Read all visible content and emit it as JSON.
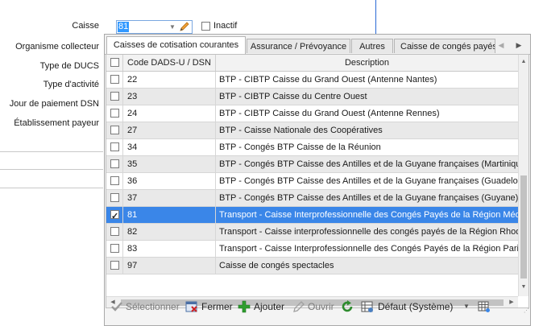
{
  "form": {
    "caisse_label": "Caisse",
    "caisse_value": "81",
    "inactif_label": "Inactif",
    "organisme_label": "Organisme collecteur",
    "type_ducs_label": "Type de DUCS",
    "type_activite_label": "Type d'activité",
    "jour_paiement_label": "Jour de paiement DSN",
    "etablissement_label": "Établissement payeur"
  },
  "tabs": [
    {
      "label": "Caisses de cotisation courantes",
      "active": true
    },
    {
      "label": "Assurance / Prévoyance",
      "active": false
    },
    {
      "label": "Autres",
      "active": false
    },
    {
      "label": "Caisse de congés payés",
      "active": false
    }
  ],
  "grid": {
    "col_code": "Code DADS-U / DSN",
    "col_desc": "Description",
    "rows": [
      {
        "code": "22",
        "desc": "BTP - CIBTP Caisse du Grand Ouest (Antenne Nantes)",
        "checked": false,
        "selected": false
      },
      {
        "code": "23",
        "desc": "BTP - CIBTP Caisse du Centre Ouest",
        "checked": false,
        "selected": false
      },
      {
        "code": "24",
        "desc": "BTP - CIBTP Caisse du Grand Ouest (Antenne Rennes)",
        "checked": false,
        "selected": false
      },
      {
        "code": "27",
        "desc": "BTP - Caisse Nationale des Coopératives",
        "checked": false,
        "selected": false
      },
      {
        "code": "34",
        "desc": "BTP - Congés BTP Caisse de la Réunion",
        "checked": false,
        "selected": false
      },
      {
        "code": "35",
        "desc": "BTP - Congés BTP Caisse des Antilles et de la Guyane françaises (Martinique)",
        "checked": false,
        "selected": false
      },
      {
        "code": "36",
        "desc": "BTP - Congés BTP Caisse des Antilles et de la Guyane françaises (Guadeloupe)",
        "checked": false,
        "selected": false
      },
      {
        "code": "37",
        "desc": "BTP - Congés BTP Caisse des Antilles et de la Guyane françaises (Guyane)",
        "checked": false,
        "selected": false
      },
      {
        "code": "81",
        "desc": "Transport - Caisse Interprofessionnelle des Congés Payés de la Région Méditerranée",
        "checked": true,
        "selected": true
      },
      {
        "code": "82",
        "desc": "Transport - Caisse interprofessionnelle des congés payés de la Région Rhodanienne",
        "checked": false,
        "selected": false
      },
      {
        "code": "83",
        "desc": "Transport - Caisse Interprofessionnelle des Congés Payés de la Région Parisienne",
        "checked": false,
        "selected": false
      },
      {
        "code": "97",
        "desc": "Caisse de congés spectacles",
        "checked": false,
        "selected": false
      }
    ]
  },
  "toolbar": {
    "select_label": "Sélectionner",
    "close_label": "Fermer",
    "add_label": "Ajouter",
    "open_label": "Ouvrir",
    "view_label": "Défaut (Système)"
  },
  "colors": {
    "accent": "#3a86e8",
    "selection_text": "#ffffff",
    "add_icon": "#2e9e2e",
    "refresh_icon": "#2e8b2e"
  }
}
